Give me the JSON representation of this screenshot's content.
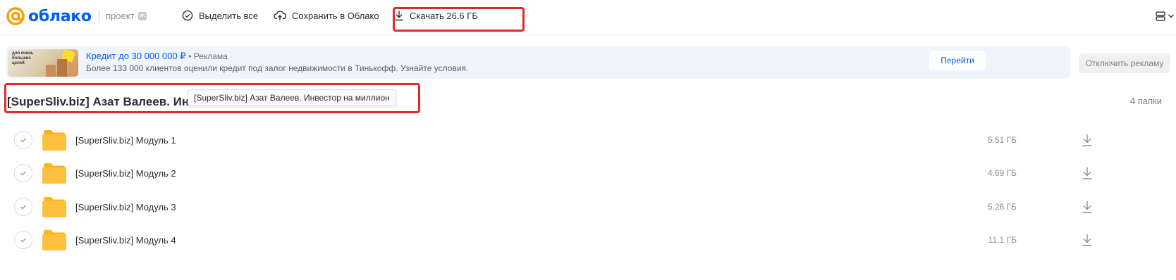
{
  "header": {
    "logo_text": "облако",
    "project_label": "проект",
    "vk_badge": "vk",
    "select_all_label": "Выделить все",
    "save_label": "Сохранить в Облако",
    "download_label": "Скачать 26.6 ГБ"
  },
  "ad": {
    "image_text": "для очень больших целей",
    "title": "Кредит до 30 000 000 ₽",
    "ad_marker": "• Реклама",
    "description": "Более 133 000 клиентов оценили кредит под залог недвижимости в Тинькофф. Узнайте условия.",
    "go_label": "Перейти",
    "disable_label": "Отключить рекламу"
  },
  "folder": {
    "title_truncated": "[SuperSliv.biz] Азат Валеев. Инв...",
    "tooltip": "[SuperSliv.biz] Азат Валеев. Инвестор на миллион",
    "count": "4 папки"
  },
  "items": [
    {
      "name": "[SuperSliv.biz] Модуль 1",
      "size": "5.51 ГБ"
    },
    {
      "name": "[SuperSliv.biz] Модуль 2",
      "size": "4.69 ГБ"
    },
    {
      "name": "[SuperSliv.biz] Модуль 3",
      "size": "5.26 ГБ"
    },
    {
      "name": "[SuperSliv.biz] Модуль 4",
      "size": "11.1 ГБ"
    }
  ],
  "icons": {
    "logo": "at-logo-icon",
    "select_all": "check-circle-icon",
    "save": "cloud-upload-icon",
    "download": "download-icon",
    "view": "view-toggle-icon",
    "folder": "folder-icon"
  },
  "colors": {
    "brand": "#005ff9",
    "logo_accent": "#ff9e00",
    "highlight": "#e02b2b",
    "folder": "#ffc13d",
    "ad_bg": "#f0f4fc"
  }
}
